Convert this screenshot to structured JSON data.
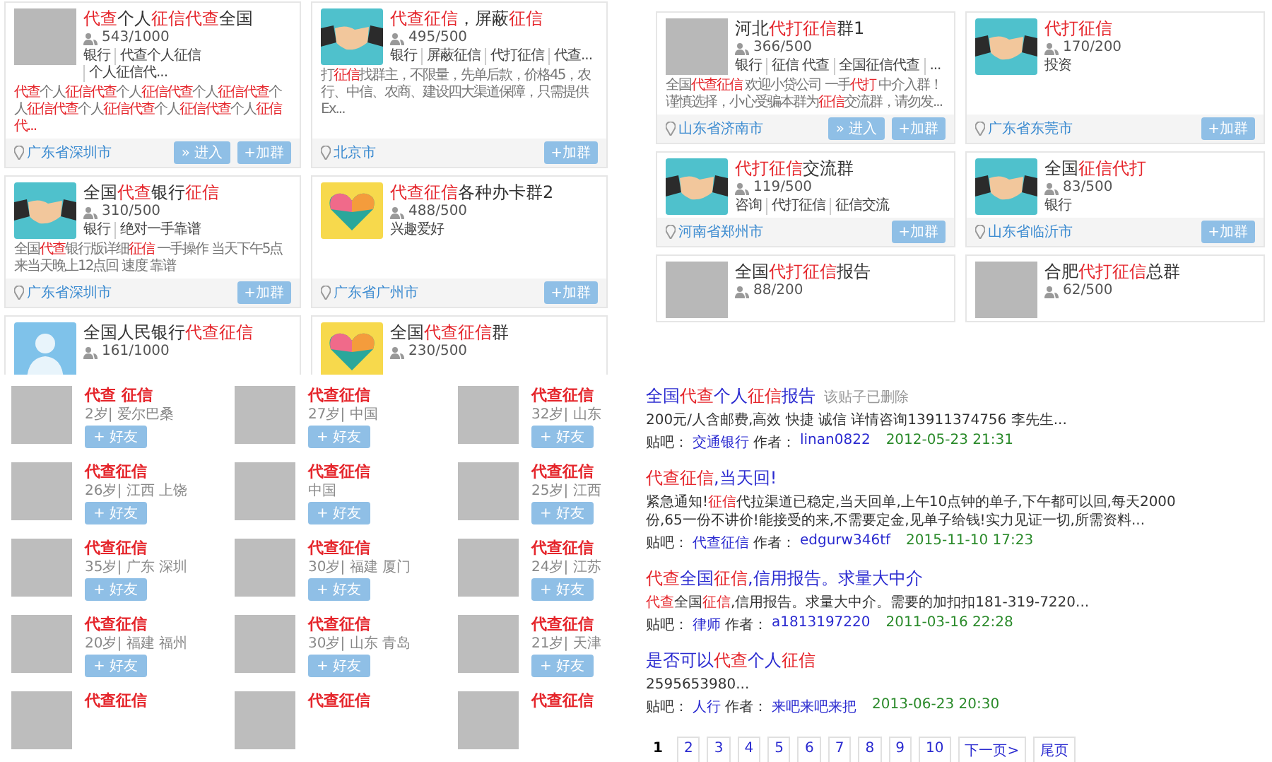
{
  "group_panels": [
    {
      "cards": [
        {
          "kind": "photo",
          "title": [
            {
              "text": "代查",
              "red": true
            },
            {
              "text": "个人",
              "red": false
            },
            {
              "text": "征信代查",
              "red": true
            },
            {
              "text": "全国",
              "red": false
            }
          ],
          "count": "543/1000",
          "tags": [
            "银行",
            "代查个人征信",
            "个人征信代..."
          ],
          "desc": [
            {
              "text": "代查",
              "red": true
            },
            {
              "text": "个人",
              "red": false
            },
            {
              "text": "征信代查",
              "red": true
            },
            {
              "text": "个人",
              "red": false
            },
            {
              "text": "征信代查",
              "red": true
            },
            {
              "text": "个人",
              "red": false
            },
            {
              "text": "征信代查",
              "red": true
            },
            {
              "text": "个人",
              "red": false
            },
            {
              "text": "征信代查",
              "red": true
            },
            {
              "text": "个人",
              "red": false
            },
            {
              "text": "征信代查",
              "red": true
            },
            {
              "text": "个人",
              "red": false
            },
            {
              "text": "征信代查",
              "red": true
            },
            {
              "text": "个人",
              "red": false
            },
            {
              "text": "征信代...",
              "red": true
            }
          ],
          "location": "广东省深圳市",
          "buttons": [
            "» 进入",
            "+加群"
          ]
        },
        {
          "kind": "handshake",
          "title": [
            {
              "text": "代查征信",
              "red": true
            },
            {
              "text": "，屏蔽",
              "red": false
            },
            {
              "text": "征信",
              "red": true
            }
          ],
          "count": "495/500",
          "tags": [
            "银行",
            "屏蔽征信",
            "代打征信",
            "代查..."
          ],
          "desc": [
            {
              "text": "打",
              "red": false
            },
            {
              "text": "征信",
              "red": true
            },
            {
              "text": "找群主，不限量，先单后款，价格45，农行、中信、农商、建设四大渠道保障，只需提供Ex...",
              "red": false
            }
          ],
          "location": "北京市",
          "buttons": [
            "+加群"
          ]
        },
        {
          "kind": "handshake",
          "title": [
            {
              "text": "全国",
              "red": false
            },
            {
              "text": "代查",
              "red": true
            },
            {
              "text": "银行",
              "red": false
            },
            {
              "text": "征信",
              "red": true
            }
          ],
          "count": "310/500",
          "tags": [
            "银行",
            "绝对一手靠谱"
          ],
          "desc": [
            {
              "text": "全国",
              "red": false
            },
            {
              "text": "代查",
              "red": true
            },
            {
              "text": "银行版详细",
              "red": false
            },
            {
              "text": "征信",
              "red": true
            },
            {
              "text": " 一手操作 当天下午5点来当天晚上12点回 速度  靠谱",
              "red": false
            }
          ],
          "location": "广东省深圳市",
          "buttons": [
            "+加群"
          ]
        },
        {
          "kind": "heart",
          "title": [
            {
              "text": "代查征信",
              "red": true
            },
            {
              "text": "各种办卡群2",
              "red": false
            }
          ],
          "count": "488/500",
          "tags": [
            "兴趣爱好"
          ],
          "location": "广东省广州市",
          "buttons": [
            "+加群"
          ]
        },
        {
          "kind": "people",
          "title": [
            {
              "text": "全国人民银行",
              "red": false
            },
            {
              "text": "代查征信",
              "red": true
            }
          ],
          "count": "161/1000"
        },
        {
          "kind": "heart",
          "title": [
            {
              "text": "全国",
              "red": false
            },
            {
              "text": "代查征信",
              "red": true
            },
            {
              "text": "群",
              "red": false
            }
          ],
          "count": "230/500"
        }
      ]
    },
    {
      "cards": [
        {
          "kind": "photo",
          "title": [
            {
              "text": "河北",
              "red": false
            },
            {
              "text": "代打征信",
              "red": true
            },
            {
              "text": "群1",
              "red": false
            }
          ],
          "count": "366/500",
          "tags": [
            "银行",
            "征信 代查",
            "全国征信代查",
            "..."
          ],
          "desc": [
            {
              "text": "全国",
              "red": false
            },
            {
              "text": "代查征信",
              "red": true
            },
            {
              "text": " 欢迎小贷公司 一手",
              "red": false
            },
            {
              "text": "代打",
              "red": true
            },
            {
              "text": " 中介入群！谨慎选择，小心受骗本群为",
              "red": false
            },
            {
              "text": "征信",
              "red": true
            },
            {
              "text": "交流群，请勿发...",
              "red": false
            }
          ],
          "location": "山东省济南市",
          "buttons": [
            "» 进入",
            "+加群"
          ]
        },
        {
          "kind": "handshake",
          "title": [
            {
              "text": "代打征信",
              "red": true
            }
          ],
          "count": "170/200",
          "tags": [
            "投资"
          ],
          "location": "广东省东莞市",
          "buttons": [
            "+加群"
          ]
        },
        {
          "kind": "handshake",
          "title": [
            {
              "text": "代打征信",
              "red": true
            },
            {
              "text": "交流群",
              "red": false
            }
          ],
          "count": "119/500",
          "tags": [
            "咨询",
            "代打征信",
            "征信交流"
          ],
          "location": "河南省郑州市",
          "buttons": [
            "+加群"
          ]
        },
        {
          "kind": "handshake",
          "title": [
            {
              "text": "全国",
              "red": false
            },
            {
              "text": "征信代打",
              "red": true
            }
          ],
          "count": "83/500",
          "tags": [
            "银行"
          ],
          "location": "山东省临沂市",
          "buttons": [
            "+加群"
          ]
        },
        {
          "kind": "photo",
          "title": [
            {
              "text": "全国",
              "red": false
            },
            {
              "text": "代打征信",
              "red": true
            },
            {
              "text": "报告",
              "red": false
            }
          ],
          "count": "88/200"
        },
        {
          "kind": "photo",
          "title": [
            {
              "text": "合肥",
              "red": false
            },
            {
              "text": "代打征信",
              "red": true
            },
            {
              "text": "总群",
              "red": false
            }
          ],
          "count": "62/500"
        }
      ]
    }
  ],
  "users": [
    {
      "name": "代查 征信",
      "info": "2岁| 爱尔巴桑",
      "button": "+ 好友"
    },
    {
      "name": "代查征信",
      "info": "27岁| 中国",
      "button": "+ 好友"
    },
    {
      "name": "代查征信",
      "info": "32岁| 山东",
      "button": "+ 好友"
    },
    {
      "name": "代查征信",
      "info": "26岁| 江西 上饶",
      "button": "+ 好友"
    },
    {
      "name": "代查征信",
      "info": "中国",
      "button": "+ 好友"
    },
    {
      "name": "代查征信",
      "info": "25岁| 江西",
      "button": "+ 好友"
    },
    {
      "name": "代查征信",
      "info": "35岁| 广东 深圳",
      "button": "+ 好友"
    },
    {
      "name": "代查征信",
      "info": "30岁| 福建 厦门",
      "button": "+ 好友"
    },
    {
      "name": "代查征信",
      "info": "24岁| 江苏",
      "button": "+ 好友"
    },
    {
      "name": "代查征信",
      "info": "20岁| 福建 福州",
      "button": "+ 好友"
    },
    {
      "name": "代查征信",
      "info": "30岁| 山东 青岛",
      "button": "+ 好友"
    },
    {
      "name": "代查征信",
      "info": "21岁| 天津",
      "button": "+ 好友"
    },
    {
      "name": "代查征信"
    },
    {
      "name": "代查征信"
    },
    {
      "name": "代查征信"
    }
  ],
  "posts": [
    {
      "title": [
        {
          "text": "全国",
          "red": false
        },
        {
          "text": "代查",
          "red": true
        },
        {
          "text": "个人",
          "red": false
        },
        {
          "text": "征信",
          "red": true
        },
        {
          "text": "报告",
          "red": false
        }
      ],
      "note": "该贴子已删除",
      "snippet": [
        {
          "text": "200元/人含邮费,高效 快捷 诚信 详情咨询13911374756 李先生...",
          "red": false
        }
      ],
      "meta": {
        "bar_label": "贴吧：",
        "bar": "交通银行",
        "author_label": "作者：",
        "author": "linan0822",
        "date": "2012-05-23 21:31"
      }
    },
    {
      "title": [
        {
          "text": "代查征信",
          "red": true
        },
        {
          "text": ",当天回!",
          "red": false
        }
      ],
      "snippet": [
        {
          "text": "紧急通知!",
          "red": false
        },
        {
          "text": "征信",
          "red": true
        },
        {
          "text": "代拉渠道已稳定,当天回单,上午10点钟的单子,下午都可以回,每天2000份,65一份不讲价!能接受的来,不需要定金,见单子给钱!实力见证一切,所需资料...",
          "red": false
        }
      ],
      "meta": {
        "bar_label": "贴吧：",
        "bar": "代查征信",
        "author_label": "作者：",
        "author": "edgurw346tf",
        "date": "2015-11-10 17:23"
      }
    },
    {
      "title": [
        {
          "text": "代查",
          "red": true
        },
        {
          "text": "全国",
          "red": false
        },
        {
          "text": "征信",
          "red": true
        },
        {
          "text": ",信用报告。求量大中介",
          "red": false
        }
      ],
      "snippet": [
        {
          "text": "代查",
          "red": true
        },
        {
          "text": "全国",
          "red": false
        },
        {
          "text": "征信",
          "red": true
        },
        {
          "text": ",信用报告。求量大中介。需要的加扣扣181-319-7220...",
          "red": false
        }
      ],
      "meta": {
        "bar_label": "贴吧：",
        "bar": "律师",
        "author_label": "作者：",
        "author": "a1813197220",
        "date": "2011-03-16 22:28"
      }
    },
    {
      "title": [
        {
          "text": "是否可以",
          "red": false
        },
        {
          "text": "代查",
          "red": true
        },
        {
          "text": "个人",
          "red": false
        },
        {
          "text": "征信",
          "red": true
        }
      ],
      "snippet": [
        {
          "text": "2595653980...",
          "red": false
        }
      ],
      "meta": {
        "bar_label": "贴吧：",
        "bar": "人行",
        "author_label": "作者：",
        "author": "来吧来吧来把",
        "date": "2013-06-23 20:30"
      }
    }
  ],
  "pagination": {
    "pages": [
      {
        "label": "1",
        "selected": true
      },
      {
        "label": "2",
        "selected": false
      },
      {
        "label": "3",
        "selected": false
      },
      {
        "label": "4",
        "selected": false
      },
      {
        "label": "5",
        "selected": false
      },
      {
        "label": "6",
        "selected": false
      },
      {
        "label": "7",
        "selected": false
      },
      {
        "label": "8",
        "selected": false
      },
      {
        "label": "9",
        "selected": false
      },
      {
        "label": "10",
        "selected": false
      }
    ],
    "next": "下一页>",
    "last": "尾页"
  }
}
